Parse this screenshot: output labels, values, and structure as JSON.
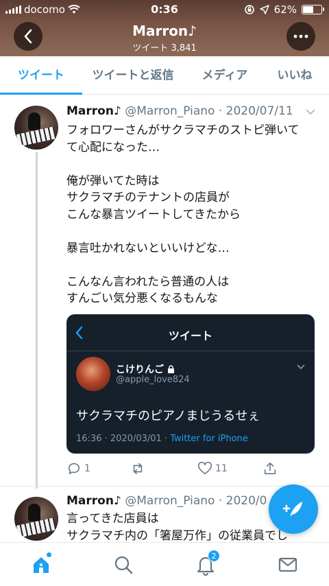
{
  "status_bar": {
    "carrier": "docomo",
    "time": "0:36",
    "battery": "62%",
    "battery_level": 0.62
  },
  "header": {
    "name": "Marron♪",
    "tweet_count": "ツイート 3,841"
  },
  "tabs": [
    {
      "label": "ツイート",
      "active": true
    },
    {
      "label": "ツイートと返信",
      "active": false
    },
    {
      "label": "メディア",
      "active": false
    },
    {
      "label": "いいね",
      "active": false
    }
  ],
  "tweet1": {
    "name": "Marron♪",
    "meta": " @Marron_Piano · 2020/07/11",
    "lines_a": [
      "フォロワーさんがサクラマチのストピ弾いて",
      "て心配になった…"
    ],
    "lines_b": [
      "俺が弾いてた時は",
      "サクラマチのテナントの店員が",
      "こんな暴言ツイートしてきたから"
    ],
    "lines_c": [
      "暴言吐かれないといいけどな…"
    ],
    "lines_d": [
      "こんなん言われたら普通の人は",
      "すんごい気分悪くなるもんな"
    ],
    "quote": {
      "screen_title": "ツイート",
      "name": "こけりんご",
      "handle": "@apple_love824",
      "text": "サクラマチのピアノまじうるせぇ",
      "time": "16:36 · 2020/03/01 · ",
      "source": "Twitter for iPhone"
    },
    "replies": "1",
    "likes": "11"
  },
  "tweet2": {
    "name": "Marron♪",
    "meta": " @Marron_Piano · 2020/0",
    "line1": "言ってきた店員は",
    "line2": "サクラマチ内の「箸屋万作」の従業員でし"
  },
  "bottom_nav": {
    "notification_badge": "2"
  },
  "colors": {
    "accent": "#1da1f2",
    "banner": "#7a5546",
    "quote_bg": "#15202b"
  }
}
